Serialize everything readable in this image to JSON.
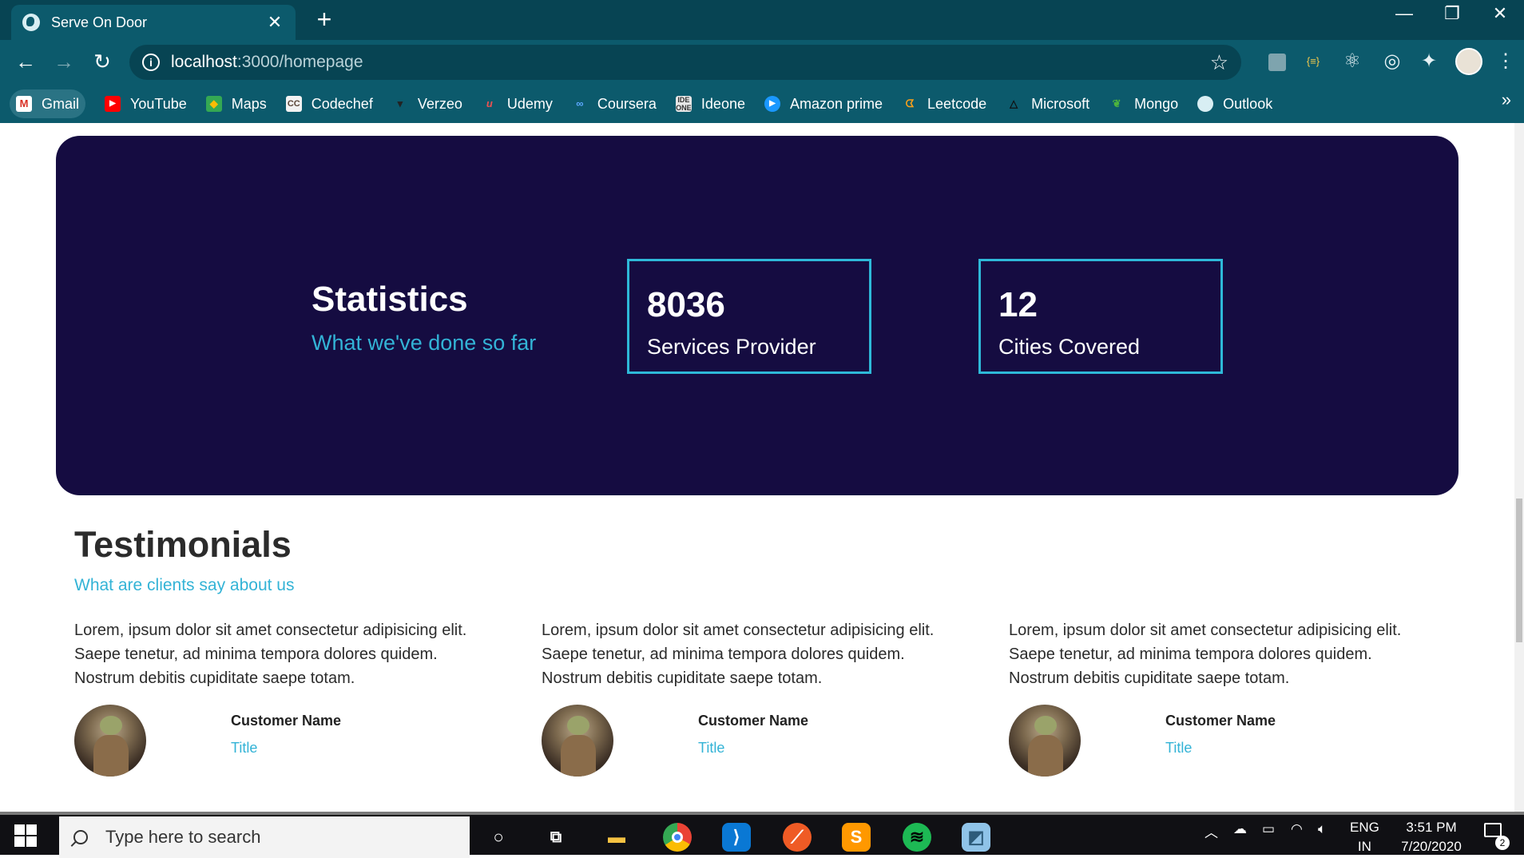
{
  "browser": {
    "tab_title": "Serve On Door",
    "tab_close": "✕",
    "new_tab": "+",
    "url_host": "localhost",
    "url_path": ":3000/homepage",
    "window_controls": {
      "minimize": "—",
      "restore": "❐",
      "close": "✕"
    },
    "nav": {
      "back": "←",
      "forward": "→",
      "reload": "↻"
    },
    "extensions": [
      "extension-square-icon",
      "json-viewer-icon",
      "react-devtools-icon",
      "target-icon",
      "puzzle-icon"
    ],
    "bookmarks": [
      {
        "label": "Gmail",
        "icon": "gmail-icon",
        "color": "#d93025"
      },
      {
        "label": "YouTube",
        "icon": "youtube-icon",
        "color": "#ff0000"
      },
      {
        "label": "Maps",
        "icon": "maps-icon",
        "color": "#34a853"
      },
      {
        "label": "Codechef",
        "icon": "codechef-icon",
        "color": "#5b4638"
      },
      {
        "label": "Verzeo",
        "icon": "verzeo-icon",
        "color": "#222222"
      },
      {
        "label": "Udemy",
        "icon": "udemy-icon",
        "color": "#ec5252"
      },
      {
        "label": "Coursera",
        "icon": "coursera-icon",
        "color": "#2a73cc"
      },
      {
        "label": "Ideone",
        "icon": "ideone-icon",
        "color": "#4a4a4a"
      },
      {
        "label": "Amazon prime",
        "icon": "prime-video-icon",
        "color": "#1a98ff"
      },
      {
        "label": "Leetcode",
        "icon": "leetcode-icon",
        "color": "#f89f1b"
      },
      {
        "label": "Microsoft",
        "icon": "microsoft-icon",
        "color": "#222222"
      },
      {
        "label": "Mongo",
        "icon": "mongodb-leaf-icon",
        "color": "#4db33d"
      },
      {
        "label": "Outlook",
        "icon": "globe-icon",
        "color": "#d8eef3"
      }
    ],
    "bookmarks_more": "»"
  },
  "stats": {
    "title": "Statistics",
    "subtitle": "What we've done so far",
    "items": [
      {
        "value": "8036",
        "label": "Services Provider"
      },
      {
        "value": "12",
        "label": "Cities Covered"
      }
    ],
    "colors": {
      "background": "#150c41",
      "accent": "#2eb9d8"
    }
  },
  "testimonials": {
    "title": "Testimonials",
    "subtitle": "What are clients say about us",
    "cards": [
      {
        "lines": [
          "Lorem, ipsum dolor sit amet consectetur adipisicing elit.",
          "Saepe tenetur, ad minima tempora dolores quidem.",
          "Nostrum debitis cupiditate saepe totam."
        ],
        "name": "Customer Name",
        "title": "Title"
      },
      {
        "lines": [
          "Lorem, ipsum dolor sit amet consectetur adipisicing elit.",
          "Saepe tenetur, ad minima tempora dolores quidem.",
          "Nostrum debitis cupiditate saepe totam."
        ],
        "name": "Customer Name",
        "title": "Title"
      },
      {
        "lines": [
          "Lorem, ipsum dolor sit amet consectetur adipisicing elit.",
          "Saepe tenetur, ad minima tempora dolores quidem.",
          "Nostrum debitis cupiditate saepe totam."
        ],
        "name": "Customer Name",
        "title": "Title"
      }
    ]
  },
  "taskbar": {
    "search_placeholder": "Type here to search",
    "apps": [
      "cortana-icon",
      "task-view-icon",
      "file-explorer-icon",
      "chrome-icon",
      "vscode-icon",
      "postman-icon",
      "sublime-text-icon",
      "spotify-icon",
      "notepad-icon"
    ],
    "language": "ENG",
    "region": "IN",
    "time": "3:51 PM",
    "date": "7/20/2020",
    "notification_count": "2"
  }
}
